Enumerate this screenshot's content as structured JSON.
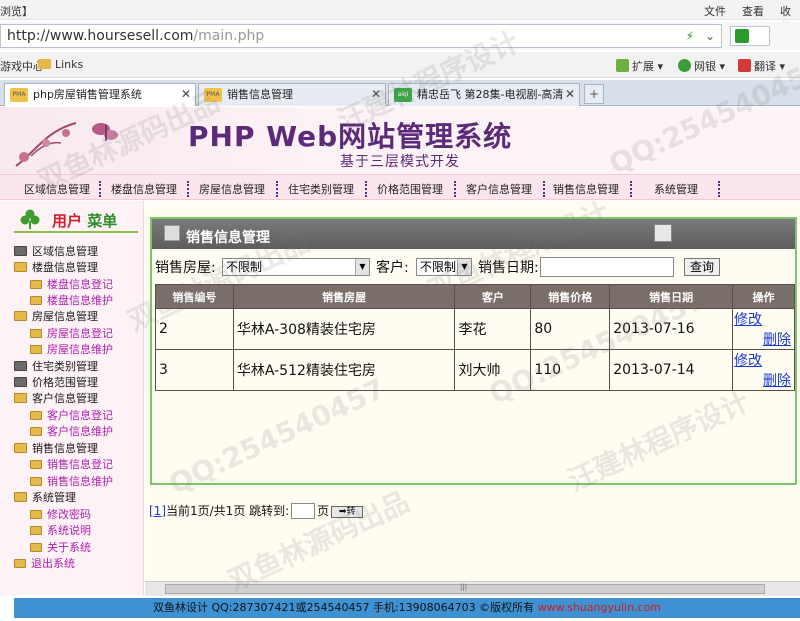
{
  "browser": {
    "window_title": "浏览】",
    "menus": [
      "文件",
      "查看",
      "收藏"
    ],
    "address": {
      "host": "http://www.hoursesell.com",
      "path": "/main.php"
    },
    "favorites": {
      "left_item": "游戏中心",
      "links": "Links",
      "tools": [
        "扩展",
        "网银",
        "翻译"
      ]
    },
    "tabs": [
      {
        "label": "php房屋销售管理系统",
        "icon_text": "PMA"
      },
      {
        "label": "销售信息管理",
        "icon_text": "PMA"
      },
      {
        "label": "精忠岳飞 第28集-电视剧-高清",
        "icon_text": "aiqi"
      }
    ]
  },
  "banner": {
    "title": "PHP Web网站管理系统",
    "subtitle": "基于三层模式开发"
  },
  "nav": [
    "区域信息管理",
    "楼盘信息管理",
    "房屋信息管理",
    "住宅类别管理",
    "价格范围管理",
    "客户信息管理",
    "销售信息管理",
    "系统管理"
  ],
  "sidebar": {
    "heading_a": "用户",
    "heading_b": "菜单",
    "items": [
      {
        "label": "区域信息管理",
        "level": 0
      },
      {
        "label": "楼盘信息管理",
        "level": 0
      },
      {
        "label": "楼盘信息登记",
        "level": 1
      },
      {
        "label": "楼盘信息维护",
        "level": 1
      },
      {
        "label": "房屋信息管理",
        "level": 0
      },
      {
        "label": "房屋信息登记",
        "level": 1
      },
      {
        "label": "房屋信息维护",
        "level": 1
      },
      {
        "label": "住宅类别管理",
        "level": 0
      },
      {
        "label": "价格范围管理",
        "level": 0
      },
      {
        "label": "客户信息管理",
        "level": 0
      },
      {
        "label": "客户信息登记",
        "level": 1
      },
      {
        "label": "客户信息维护",
        "level": 1
      },
      {
        "label": "销售信息管理",
        "level": 0
      },
      {
        "label": "销售信息登记",
        "level": 1
      },
      {
        "label": "销售信息维护",
        "level": 1
      },
      {
        "label": "系统管理",
        "level": 0
      },
      {
        "label": "修改密码",
        "level": 1
      },
      {
        "label": "系统说明",
        "level": 1
      },
      {
        "label": "关于系统",
        "level": 1
      },
      {
        "label": "退出系统",
        "level": 0
      }
    ]
  },
  "main": {
    "panel_title": "销售信息管理",
    "filters": {
      "house_label": "销售房屋:",
      "house_value": "不限制",
      "customer_label": "客户:",
      "customer_value": "不限制",
      "date_label": "销售日期:",
      "date_value": "",
      "search_button": "查询"
    },
    "columns": [
      "销售编号",
      "销售房屋",
      "客户",
      "销售价格",
      "销售日期",
      "操作"
    ],
    "rows": [
      {
        "id": "2",
        "house": "华林A-308精装住宅房",
        "customer": "李花",
        "price": "80",
        "date": "2013-07-16",
        "edit": "修改",
        "delete": "删除"
      },
      {
        "id": "3",
        "house": "华林A-512精装住宅房",
        "customer": "刘大帅",
        "price": "110",
        "date": "2013-07-14",
        "edit": "修改",
        "delete": "删除"
      }
    ],
    "pager": {
      "page_link": "[1]",
      "info": "当前1页/共1页 跳转到:",
      "page_unit": "页",
      "go": "➡转"
    }
  },
  "footer": {
    "text": "双鱼林设计 QQ:287307421或254540457 手机:13908064703 ©版权所有 ",
    "url": "www.shuangyulin.com"
  },
  "watermarks": [
    "双鱼林源码出品",
    "汪建林程序设计",
    "QQ:254540457",
    "双鱼林程序设计",
    "双鱼林源码出品",
    "汪建林程序设计",
    "QQ:254540457",
    "双鱼林源码出品",
    "QQ:254540457"
  ],
  "colors": {
    "accent_green": "#7dc66a",
    "header_gray": "#7a6e69",
    "footer_blue": "#3e92d3",
    "title_purple": "#5b2a78",
    "link_blue": "#1a3ad6"
  }
}
